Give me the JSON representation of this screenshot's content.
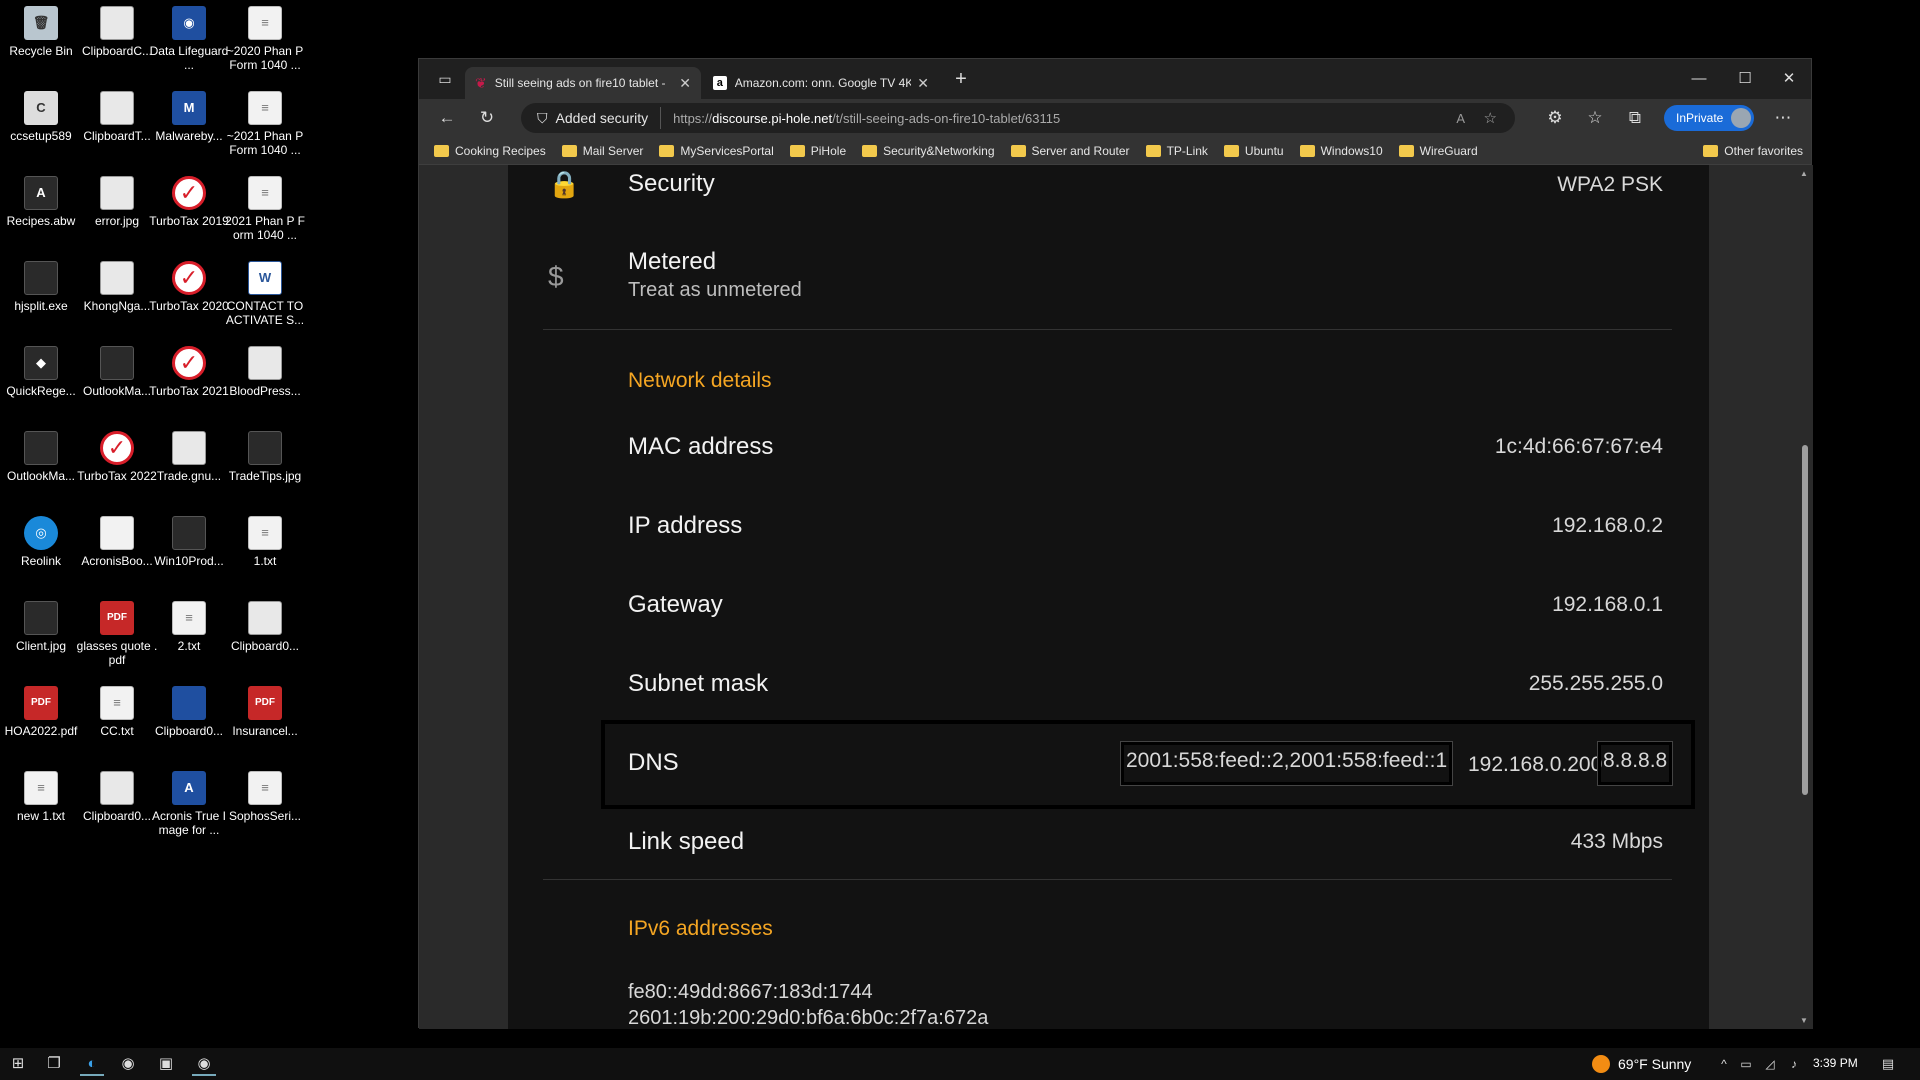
{
  "desktop": {
    "icons": [
      {
        "label": "Recycle Bin",
        "glyph": "🗑",
        "kind": "bin"
      },
      {
        "label": "ClipboardC...",
        "glyph": "",
        "kind": "img"
      },
      {
        "label": "Data Lifeguard ...",
        "glyph": "◉",
        "kind": "blue"
      },
      {
        "label": "~2020 Phan P Form 1040 ...",
        "glyph": "≡",
        "kind": "doc"
      },
      {
        "label": "ccsetup589",
        "glyph": "C",
        "kind": "exe"
      },
      {
        "label": "ClipboardT...",
        "glyph": "",
        "kind": "img"
      },
      {
        "label": "Malwareby...",
        "glyph": "M",
        "kind": "blue"
      },
      {
        "label": "~2021 Phan P Form 1040 ...",
        "glyph": "≡",
        "kind": "doc"
      },
      {
        "label": "Recipes.abw",
        "glyph": "A",
        "kind": "dark"
      },
      {
        "label": "error.jpg",
        "glyph": "",
        "kind": "img"
      },
      {
        "label": "TurboTax 2019",
        "glyph": "✓",
        "kind": "tt"
      },
      {
        "label": "2021 Phan P Form 1040 ...",
        "glyph": "≡",
        "kind": "doc"
      },
      {
        "label": "hjsplit.exe",
        "glyph": "",
        "kind": "dark"
      },
      {
        "label": "KhongNga...",
        "glyph": "",
        "kind": "img"
      },
      {
        "label": "TurboTax 2020",
        "glyph": "✓",
        "kind": "tt"
      },
      {
        "label": "CONTACT TO ACTIVATE S...",
        "glyph": "W",
        "kind": "word"
      },
      {
        "label": "QuickRege...",
        "glyph": "◆",
        "kind": "dark"
      },
      {
        "label": "OutlookMa...",
        "glyph": "",
        "kind": "dark"
      },
      {
        "label": "TurboTax 2021",
        "glyph": "✓",
        "kind": "tt"
      },
      {
        "label": "BloodPress...",
        "glyph": "",
        "kind": "img"
      },
      {
        "label": "OutlookMa...",
        "glyph": "",
        "kind": "dark"
      },
      {
        "label": "TurboTax 2022",
        "glyph": "✓",
        "kind": "tt"
      },
      {
        "label": "Trade.gnu...",
        "glyph": "",
        "kind": "img"
      },
      {
        "label": "TradeTips.jpg",
        "glyph": "",
        "kind": "dark"
      },
      {
        "label": "Reolink",
        "glyph": "◎",
        "kind": "reo"
      },
      {
        "label": "AcronisBoo...",
        "glyph": "",
        "kind": "doc"
      },
      {
        "label": "Win10Prod...",
        "glyph": "",
        "kind": "dark"
      },
      {
        "label": "1.txt",
        "glyph": "≡",
        "kind": "doc"
      },
      {
        "label": "Client.jpg",
        "glyph": "",
        "kind": "dark"
      },
      {
        "label": "glasses quote .pdf",
        "glyph": "PDF",
        "kind": "pdf"
      },
      {
        "label": "2.txt",
        "glyph": "≡",
        "kind": "doc"
      },
      {
        "label": "Clipboard0...",
        "glyph": "",
        "kind": "img"
      },
      {
        "label": "HOA2022.pdf",
        "glyph": "PDF",
        "kind": "pdf"
      },
      {
        "label": "CC.txt",
        "glyph": "≡",
        "kind": "doc"
      },
      {
        "label": "Clipboard0...",
        "glyph": "",
        "kind": "blue"
      },
      {
        "label": "Insurancel...",
        "glyph": "PDF",
        "kind": "pdf"
      },
      {
        "label": "new 1.txt",
        "glyph": "≡",
        "kind": "doc"
      },
      {
        "label": "Clipboard0...",
        "glyph": "",
        "kind": "img"
      },
      {
        "label": "Acronis True Image for ...",
        "glyph": "A",
        "kind": "blue"
      },
      {
        "label": "SophosSeri...",
        "glyph": "≡",
        "kind": "doc"
      }
    ]
  },
  "browser": {
    "tabs": [
      {
        "title": "Still seeing ads on fire10 tablet -",
        "icon": "raspberry-icon"
      },
      {
        "title": "Amazon.com: onn. Google TV 4K",
        "icon": "amazon-icon"
      }
    ],
    "new_tab": "+",
    "security_label": "Added security",
    "url_prefix": "https://",
    "url_domain": "discourse.pi-hole.net",
    "url_path": "/t/still-seeing-ads-on-fire10-tablet/63115",
    "inprivate": "InPrivate",
    "favorites": [
      "Cooking Recipes",
      "Mail Server",
      "MyServicesPortal",
      "PiHole",
      "Security&Networking",
      "Server and Router",
      "TP-Link",
      "Ubuntu",
      "Windows10",
      "WireGuard"
    ],
    "other_favorites": "Other favorites"
  },
  "screen": {
    "security_label": "Security",
    "security_value": "WPA2 PSK",
    "metered_label": "Metered",
    "metered_sub": "Treat as unmetered",
    "metered_icon": "$",
    "network_details": "Network details",
    "mac_label": "MAC address",
    "mac_value": "1c:4d:66:67:67:e4",
    "ip_label": "IP address",
    "ip_value": "192.168.0.2",
    "gateway_label": "Gateway",
    "gateway_value": "192.168.0.1",
    "subnet_label": "Subnet mask",
    "subnet_value": "255.255.255.0",
    "dns_label": "DNS",
    "dns_v6": "2001:558:feed::2,2001:558:feed::1",
    "dns_local": "192.168.0.200",
    "dns_google": "8.8.8.8",
    "link_label": "Link speed",
    "link_value": "433 Mbps",
    "ipv6_heading": "IPv6 addresses",
    "ipv6_1": "fe80::49dd:8667:183d:1744",
    "ipv6_2": "2601:19b:200:29d0:bf6a:6b0c:2f7a:672a"
  },
  "taskbar": {
    "weather": "69°F  Sunny",
    "time": "3:39 PM"
  }
}
